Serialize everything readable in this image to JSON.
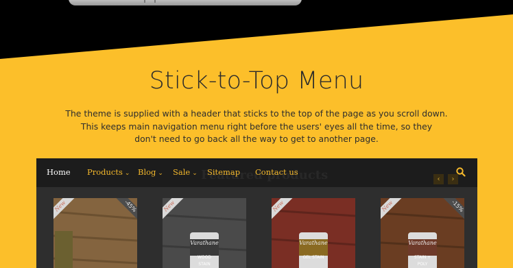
{
  "hero": {
    "title": "Stick-to-Top Menu",
    "description_lines": [
      "The theme is supplied with a header that sticks to the top of the page as you scroll down.",
      "This keeps main navigation menu right before the users' eyes all the time, so they",
      "don't need to go back all the way to get to another page."
    ]
  },
  "preview": {
    "nav": {
      "items": [
        {
          "label": "Home",
          "dropdown": false
        },
        {
          "label": "Products",
          "dropdown": true
        },
        {
          "label": "Blog",
          "dropdown": true
        },
        {
          "label": "Sale",
          "dropdown": true
        },
        {
          "label": "Sitemap",
          "dropdown": false
        },
        {
          "label": "Contact us",
          "dropdown": false
        }
      ],
      "search_icon": "search-icon",
      "caret_glyph": "⌄"
    },
    "section_title": "Featured products",
    "prev_glyph": "‹",
    "next_glyph": "›",
    "products": [
      {
        "badge": "New",
        "sale": "-45%",
        "colors": [
          "#8b6a43",
          "#6b5030"
        ]
      },
      {
        "badge": "New",
        "sale": "",
        "colors": [
          "#5a5a5a",
          "#444444"
        ],
        "can_label": "Varathane",
        "can_sub": "WOOD STAIN"
      },
      {
        "badge": "New",
        "sale": "",
        "colors": [
          "#a33b2c",
          "#7a2a20"
        ],
        "can_label": "Varathane",
        "can_sub": "GEL STAIN"
      },
      {
        "badge": "New",
        "sale": "-15%",
        "colors": [
          "#8b4e2b",
          "#6a3a20"
        ],
        "can_label": "Varathane",
        "can_sub": "STAIN + POLY"
      }
    ]
  },
  "colors": {
    "accent": "#fcbf2a",
    "nav_bg": "#1c1c1c",
    "nav_link": "#f5b92c"
  }
}
